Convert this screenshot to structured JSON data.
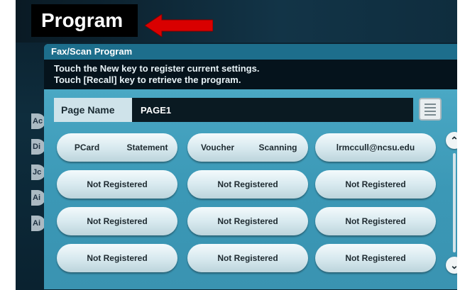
{
  "banner": {
    "title": "Program"
  },
  "left_tabs": [
    "Ac",
    "Di",
    "Jc",
    "Ai",
    "Ai"
  ],
  "dialog": {
    "title": "Fax/Scan Program",
    "message_line1": "Touch the New key to register current settings.",
    "message_line2": "Touch [Recall] key to retrieve the program.",
    "page_name_label": "Page Name",
    "page_name_value": "PAGE1"
  },
  "programs": [
    {
      "parts": [
        "PCard",
        "Statement"
      ]
    },
    {
      "parts": [
        "Voucher",
        "Scanning"
      ]
    },
    {
      "parts": [
        "lrmccull@ncsu.edu"
      ]
    },
    {
      "parts": [
        "Not Registered"
      ]
    },
    {
      "parts": [
        "Not Registered"
      ]
    },
    {
      "parts": [
        "Not Registered"
      ]
    },
    {
      "parts": [
        "Not Registered"
      ]
    },
    {
      "parts": [
        "Not Registered"
      ]
    },
    {
      "parts": [
        "Not Registered"
      ]
    },
    {
      "parts": [
        "Not Registered"
      ]
    },
    {
      "parts": [
        "Not Registered"
      ]
    },
    {
      "parts": [
        "Not Registered"
      ]
    }
  ],
  "colors": {
    "arrow": "#d90000",
    "dialog": "#2a8aa8",
    "banner": "#000000"
  },
  "icons": {
    "scroll_up": "chevron-up-icon",
    "scroll_down": "chevron-down-icon",
    "page_list": "document-list-icon"
  }
}
